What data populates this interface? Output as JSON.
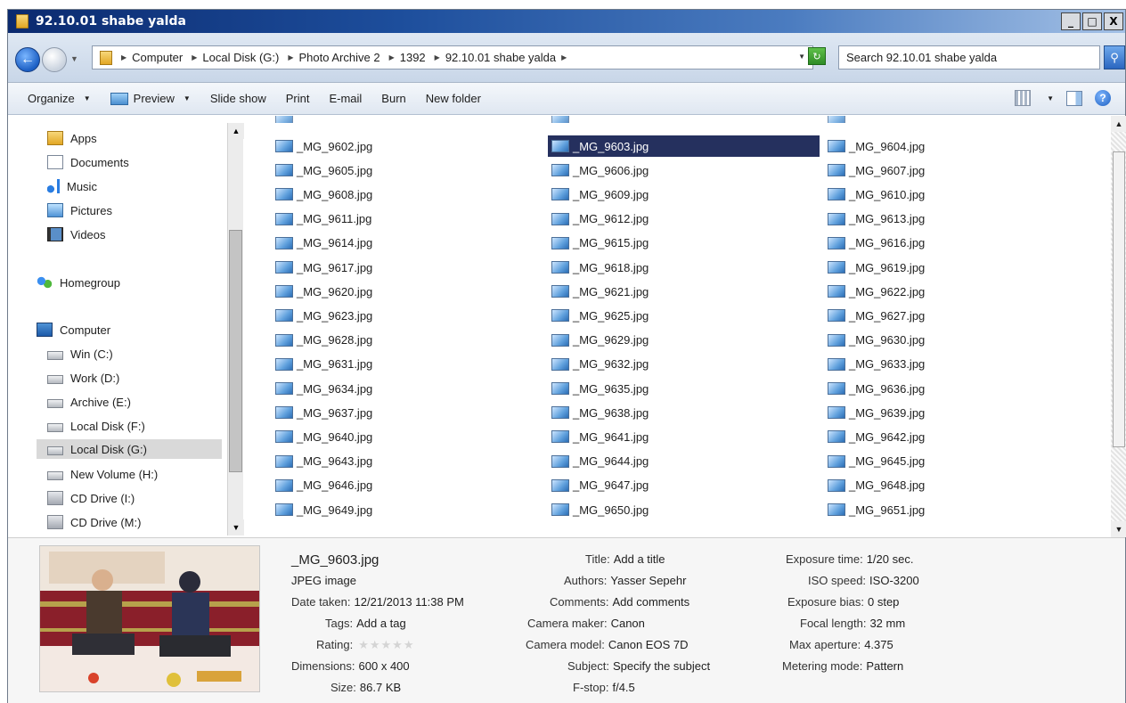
{
  "window": {
    "title": "92.10.01 shabe yalda",
    "min_label": "_",
    "max_label": "□",
    "close_label": "X"
  },
  "address": {
    "crumbs": [
      "Computer",
      "Local Disk (G:)",
      "Photo Archive 2",
      "1392",
      "92.10.01 shabe yalda"
    ],
    "search_placeholder": "Search 92.10.01 shabe yalda"
  },
  "toolbar": {
    "organize": "Organize",
    "preview": "Preview",
    "slideshow": "Slide show",
    "print": "Print",
    "email": "E-mail",
    "burn": "Burn",
    "new_folder": "New folder"
  },
  "nav": {
    "items": [
      {
        "label": "Apps",
        "icon": "folder-icon"
      },
      {
        "label": "Documents",
        "icon": "documents-icon"
      },
      {
        "label": "Music",
        "icon": "music-icon"
      },
      {
        "label": "Pictures",
        "icon": "pictures-icon"
      },
      {
        "label": "Videos",
        "icon": "videos-icon"
      },
      {
        "label": "Homegroup",
        "icon": "homegroup-icon"
      },
      {
        "label": "Computer",
        "icon": "computer-icon"
      },
      {
        "label": "Win (C:)",
        "icon": "drive-icon"
      },
      {
        "label": "Work (D:)",
        "icon": "drive-icon"
      },
      {
        "label": "Archive (E:)",
        "icon": "drive-icon"
      },
      {
        "label": "Local Disk (F:)",
        "icon": "drive-icon"
      },
      {
        "label": "Local Disk (G:)",
        "icon": "drive-icon"
      },
      {
        "label": "New Volume (H:)",
        "icon": "drive-icon"
      },
      {
        "label": "CD Drive (I:)",
        "icon": "cd-drive-icon"
      },
      {
        "label": "CD Drive (M:)",
        "icon": "cd-drive-icon"
      }
    ],
    "selected": "Local Disk (G:)"
  },
  "files": {
    "col1": [
      "_MG_9602.jpg",
      "_MG_9605.jpg",
      "_MG_9608.jpg",
      "_MG_9611.jpg",
      "_MG_9614.jpg",
      "_MG_9617.jpg",
      "_MG_9620.jpg",
      "_MG_9623.jpg",
      "_MG_9628.jpg",
      "_MG_9631.jpg",
      "_MG_9634.jpg",
      "_MG_9637.jpg",
      "_MG_9640.jpg",
      "_MG_9643.jpg",
      "_MG_9646.jpg",
      "_MG_9649.jpg"
    ],
    "col2": [
      "_MG_9603.jpg",
      "_MG_9606.jpg",
      "_MG_9609.jpg",
      "_MG_9612.jpg",
      "_MG_9615.jpg",
      "_MG_9618.jpg",
      "_MG_9621.jpg",
      "_MG_9625.jpg",
      "_MG_9629.jpg",
      "_MG_9632.jpg",
      "_MG_9635.jpg",
      "_MG_9638.jpg",
      "_MG_9641.jpg",
      "_MG_9644.jpg",
      "_MG_9647.jpg",
      "_MG_9650.jpg"
    ],
    "col3": [
      "_MG_9604.jpg",
      "_MG_9607.jpg",
      "_MG_9610.jpg",
      "_MG_9613.jpg",
      "_MG_9616.jpg",
      "_MG_9619.jpg",
      "_MG_9622.jpg",
      "_MG_9627.jpg",
      "_MG_9630.jpg",
      "_MG_9633.jpg",
      "_MG_9636.jpg",
      "_MG_9639.jpg",
      "_MG_9642.jpg",
      "_MG_9645.jpg",
      "_MG_9648.jpg",
      "_MG_9651.jpg"
    ],
    "selected": "_MG_9603.jpg"
  },
  "details": {
    "name": "_MG_9603.jpg",
    "type": "JPEG image",
    "col1": [
      {
        "k": "Date taken:",
        "v": "12/21/2013 11:38 PM"
      },
      {
        "k": "Tags:",
        "v": "Add a tag"
      },
      {
        "k": "Rating:",
        "v": ""
      },
      {
        "k": "Dimensions:",
        "v": "600 x 400"
      },
      {
        "k": "Size:",
        "v": "86.7 KB"
      }
    ],
    "col2": [
      {
        "k": "Title:",
        "v": "Add a title"
      },
      {
        "k": "Authors:",
        "v": "Yasser Sepehr"
      },
      {
        "k": "Comments:",
        "v": "Add comments"
      },
      {
        "k": "Camera maker:",
        "v": "Canon"
      },
      {
        "k": "Camera model:",
        "v": "Canon EOS 7D"
      },
      {
        "k": "Subject:",
        "v": "Specify the subject"
      },
      {
        "k": "F-stop:",
        "v": "f/4.5"
      }
    ],
    "col3": [
      {
        "k": "Exposure time:",
        "v": "1/20 sec."
      },
      {
        "k": "ISO speed:",
        "v": "ISO-3200"
      },
      {
        "k": "Exposure bias:",
        "v": "0 step"
      },
      {
        "k": "Focal length:",
        "v": "32 mm"
      },
      {
        "k": "Max aperture:",
        "v": "4.375"
      },
      {
        "k": "Metering mode:",
        "v": "Pattern"
      }
    ],
    "rating_stars": "★★★★★"
  }
}
